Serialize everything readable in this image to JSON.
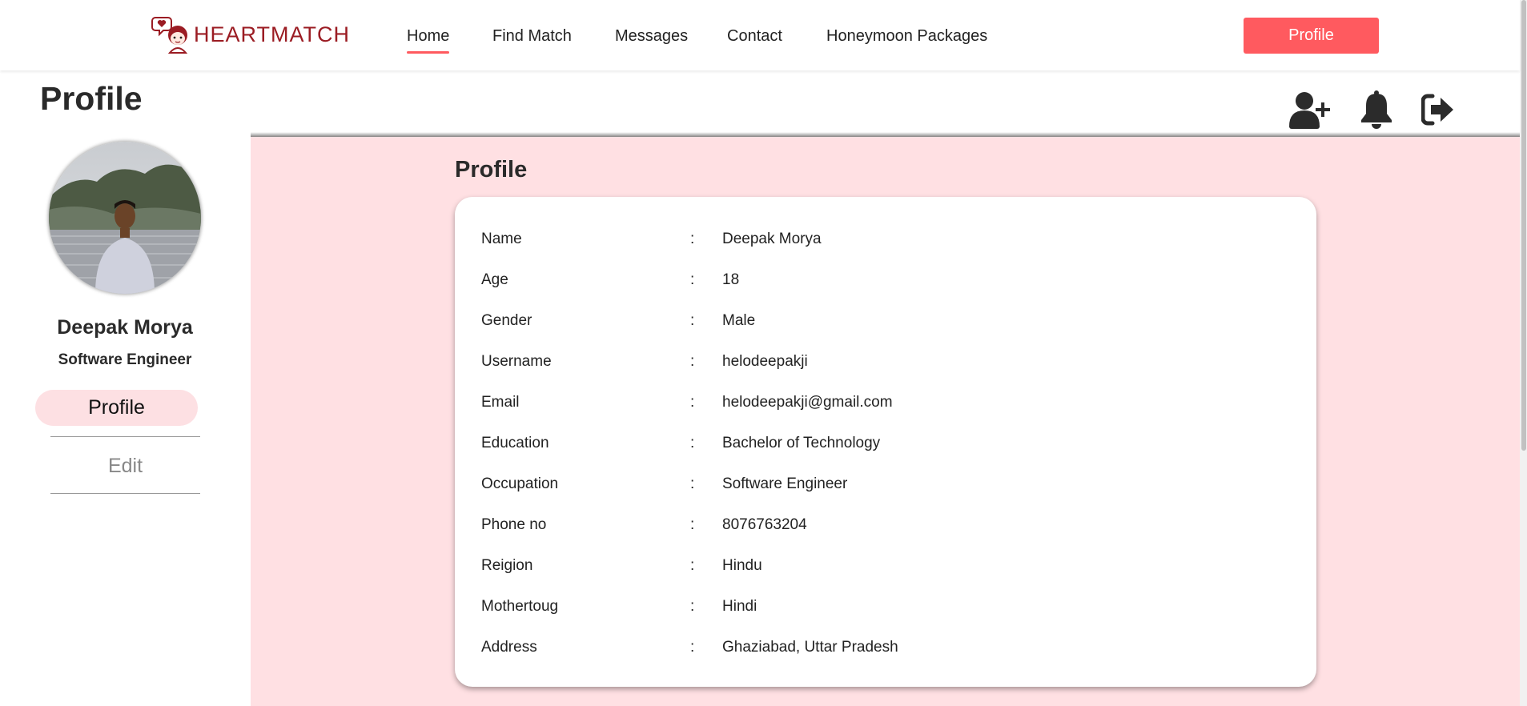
{
  "brand": {
    "name": "HEARTMATCH",
    "color": "#9b1c23",
    "icon": "heart-mascot-logo"
  },
  "nav": {
    "items": [
      {
        "label": "Home",
        "active": true
      },
      {
        "label": "Find Match"
      },
      {
        "label": "Messages"
      },
      {
        "label": "Contact"
      },
      {
        "label": "Honeymoon Packages"
      }
    ],
    "profile_button": "Profile",
    "accent": "#ff5a5f"
  },
  "page": {
    "title": "Profile"
  },
  "header_icons": [
    "add-user-icon",
    "bell-icon",
    "logout-icon"
  ],
  "sidebar": {
    "name": "Deepak Morya",
    "role": "Software Engineer",
    "menu": [
      {
        "label": "Profile",
        "active": true
      },
      {
        "label": "Edit"
      }
    ]
  },
  "main": {
    "title": "Profile",
    "background": "#ffe0e3",
    "fields": [
      {
        "label": "Name",
        "sep": ":",
        "value": "Deepak Morya"
      },
      {
        "label": "Age",
        "sep": ":",
        "value": "18"
      },
      {
        "label": "Gender",
        "sep": ":",
        "value": "Male"
      },
      {
        "label": "Username",
        "sep": ":",
        "value": "helodeepakji"
      },
      {
        "label": "Email",
        "sep": ":",
        "value": "helodeepakji@gmail.com"
      },
      {
        "label": "Education",
        "sep": ":",
        "value": "Bachelor of Technology"
      },
      {
        "label": "Occupation",
        "sep": ":",
        "value": "Software Engineer"
      },
      {
        "label": "Phone no",
        "sep": ":",
        "value": "8076763204"
      },
      {
        "label": "Reigion",
        "sep": ":",
        "value": "Hindu"
      },
      {
        "label": "Mothertoug",
        "sep": ":",
        "value": "Hindi"
      },
      {
        "label": "Address",
        "sep": ":",
        "value": "Ghaziabad, Uttar Pradesh"
      }
    ]
  }
}
